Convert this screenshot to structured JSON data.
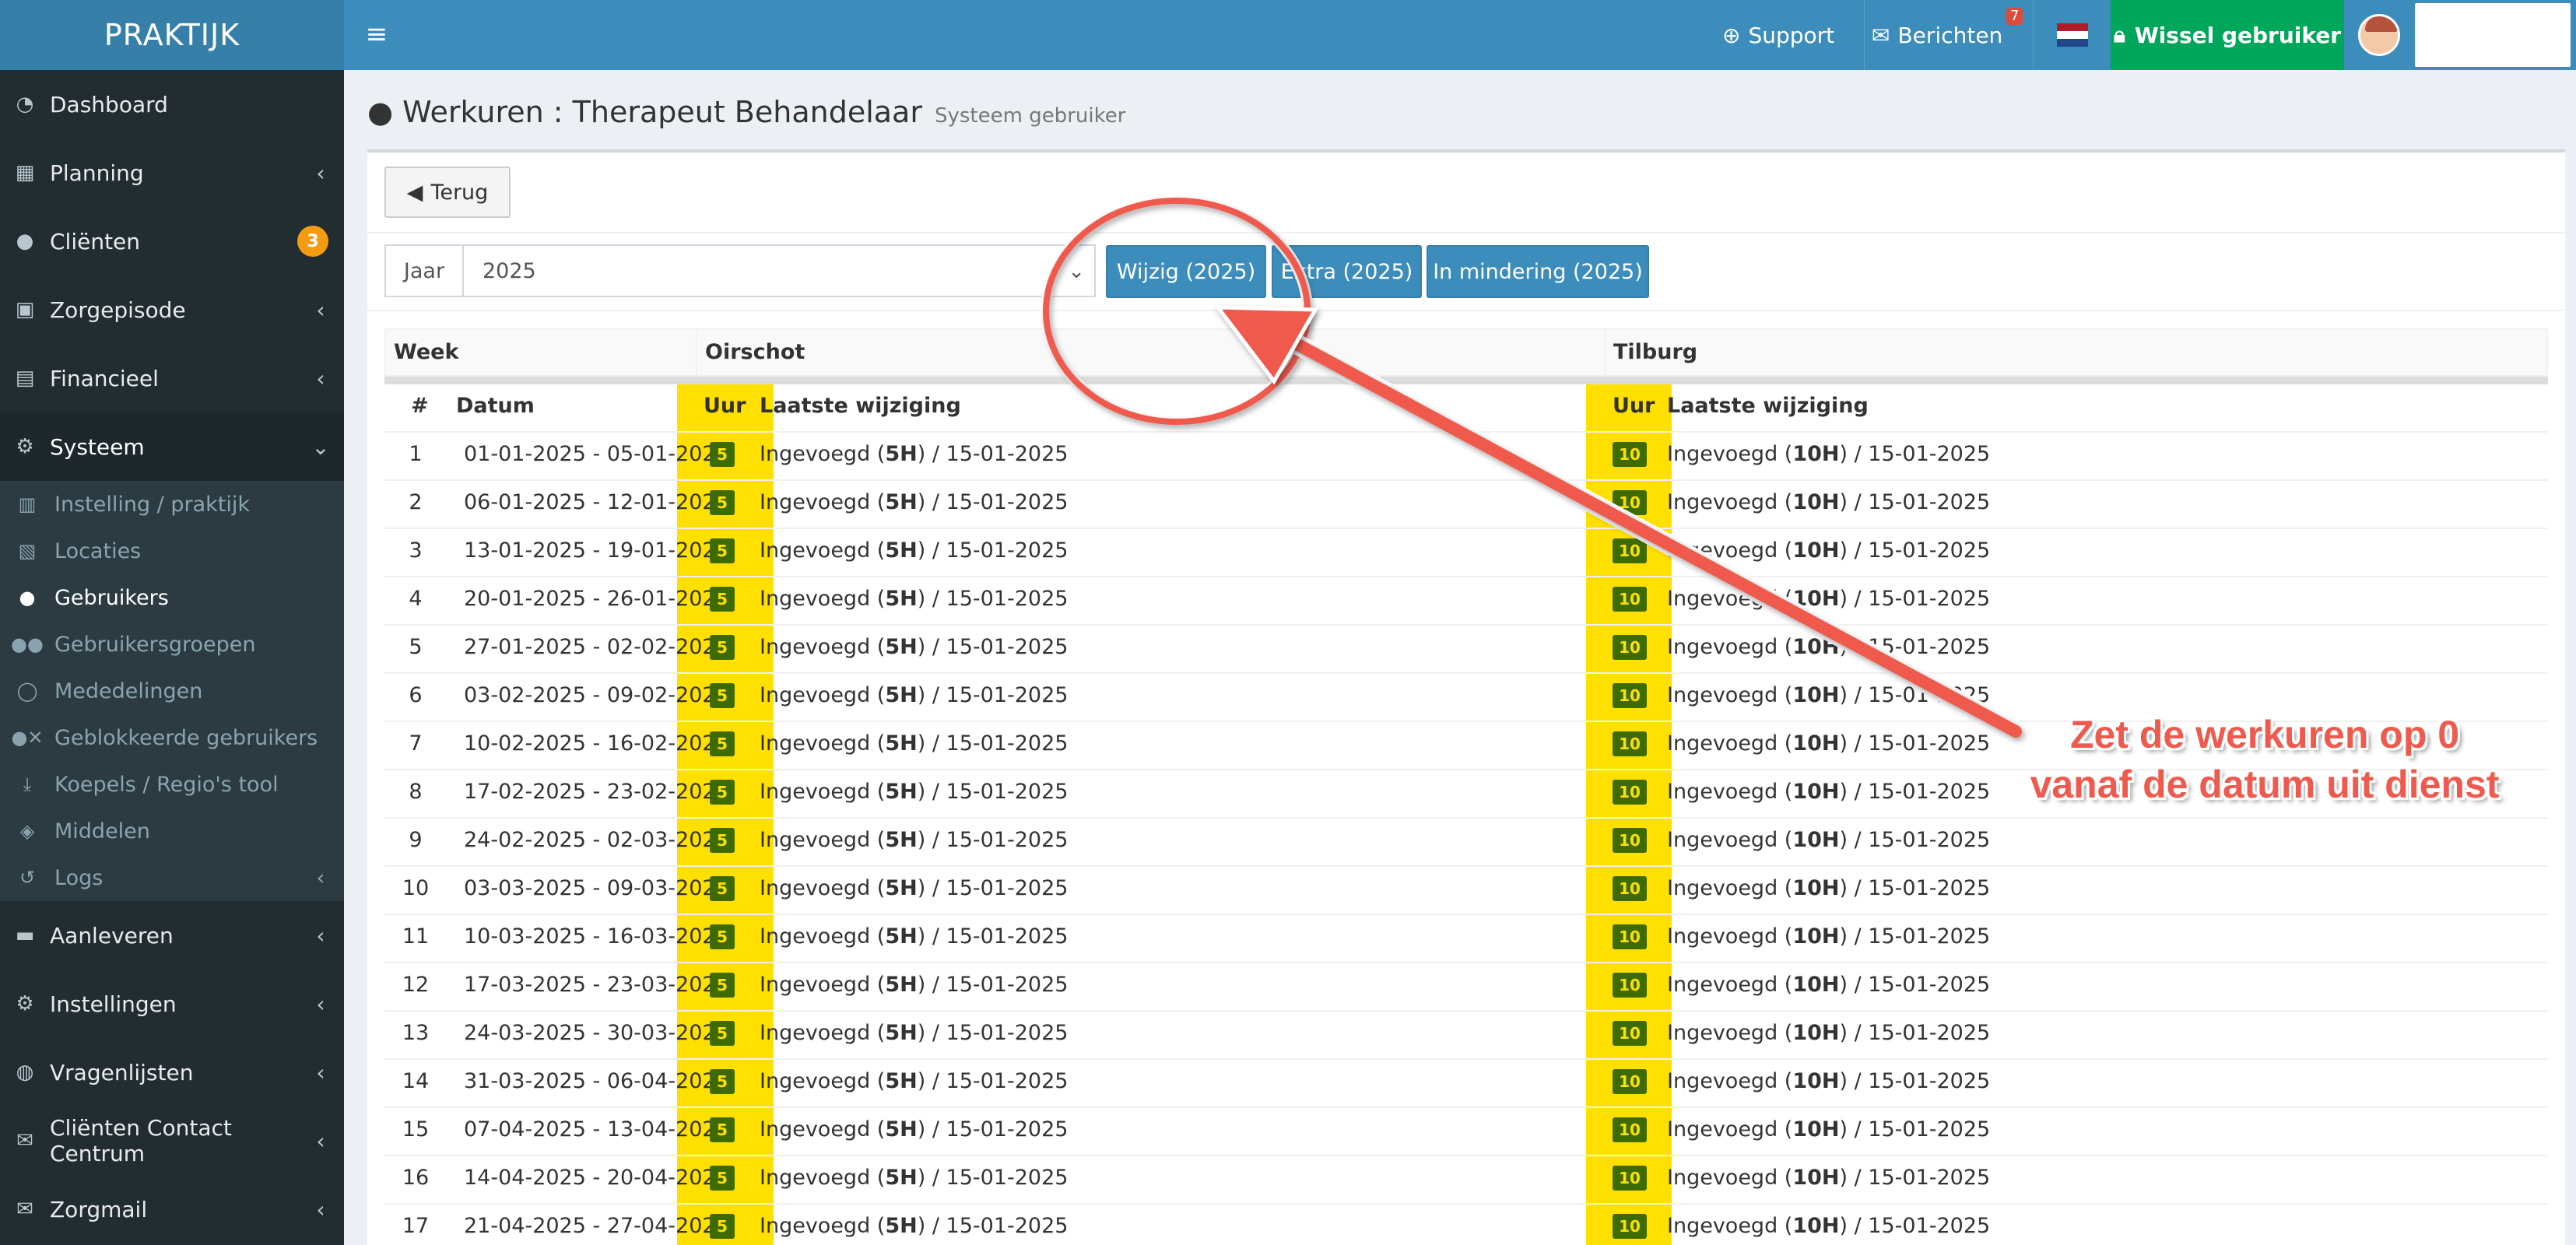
{
  "header": {
    "logo": "PRAKTIJK",
    "support": "Support",
    "berichten": "Berichten",
    "berichten_count": "7",
    "wissel": "Wissel gebruiker"
  },
  "sidebar": {
    "items": [
      {
        "label": "Dashboard",
        "icon": "dashboard-icon"
      },
      {
        "label": "Planning",
        "icon": "calendar-icon"
      },
      {
        "label": "Cliënten",
        "icon": "user-icon",
        "badge": "3"
      },
      {
        "label": "Zorgepisode",
        "icon": "medkit-icon"
      },
      {
        "label": "Financieel",
        "icon": "book-icon"
      },
      {
        "label": "Systeem",
        "icon": "cogs-icon"
      }
    ],
    "sub_items": [
      {
        "label": "Instelling / praktijk",
        "icon": "clipboard-icon"
      },
      {
        "label": "Locaties",
        "icon": "map-icon"
      },
      {
        "label": "Gebruikers",
        "icon": "user-icon"
      },
      {
        "label": "Gebruikersgroepen",
        "icon": "users-icon"
      },
      {
        "label": "Mededelingen",
        "icon": "comment-icon"
      },
      {
        "label": "Geblokkeerde gebruikers",
        "icon": "user-block-icon"
      },
      {
        "label": "Koepels / Regio's tool",
        "icon": "download-icon"
      },
      {
        "label": "Middelen",
        "icon": "cubes-icon"
      },
      {
        "label": "Logs",
        "icon": "history-icon"
      }
    ],
    "bottom_items": [
      {
        "label": "Aanleveren",
        "icon": "truck-icon"
      },
      {
        "label": "Instellingen",
        "icon": "gear-icon"
      },
      {
        "label": "Vragenlijsten",
        "icon": "globe-icon"
      },
      {
        "label": "Cliënten Contact Centrum",
        "icon": "envelope-icon"
      },
      {
        "label": "Zorgmail",
        "icon": "envelope-icon"
      }
    ]
  },
  "page": {
    "title": "Werkuren : Therapeut Behandelaar",
    "subtitle": "Systeem gebruiker",
    "back_label": "Terug",
    "year_label": "Jaar",
    "year_value": "2025",
    "btn_wijzig": "Wijzig (2025)",
    "btn_extra": "Extra (2025)",
    "btn_mindering": "In mindering (2025)"
  },
  "table": {
    "h_week": "Week",
    "h_loc1": "Oirschot",
    "h_loc2": "Tilburg",
    "h_num": "#",
    "h_datum": "Datum",
    "h_uur": "Uur",
    "h_laatste": "Laatste wijziging",
    "rows": [
      {
        "n": "1",
        "datum": "01-01-2025 - 05-01-2025"
      },
      {
        "n": "2",
        "datum": "06-01-2025 - 12-01-2025"
      },
      {
        "n": "3",
        "datum": "13-01-2025 - 19-01-2025"
      },
      {
        "n": "4",
        "datum": "20-01-2025 - 26-01-2025"
      },
      {
        "n": "5",
        "datum": "27-01-2025 - 02-02-2025"
      },
      {
        "n": "6",
        "datum": "03-02-2025 - 09-02-2025"
      },
      {
        "n": "7",
        "datum": "10-02-2025 - 16-02-2025"
      },
      {
        "n": "8",
        "datum": "17-02-2025 - 23-02-2025"
      },
      {
        "n": "9",
        "datum": "24-02-2025 - 02-03-2025"
      },
      {
        "n": "10",
        "datum": "03-03-2025 - 09-03-2025"
      },
      {
        "n": "11",
        "datum": "10-03-2025 - 16-03-2025"
      },
      {
        "n": "12",
        "datum": "17-03-2025 - 23-03-2025"
      },
      {
        "n": "13",
        "datum": "24-03-2025 - 30-03-2025"
      },
      {
        "n": "14",
        "datum": "31-03-2025 - 06-04-2025"
      },
      {
        "n": "15",
        "datum": "07-04-2025 - 13-04-2025"
      },
      {
        "n": "16",
        "datum": "14-04-2025 - 20-04-2025"
      },
      {
        "n": "17",
        "datum": "21-04-2025 - 27-04-2025"
      }
    ],
    "loc1": {
      "uur": "5",
      "pre": "Ingevoegd (",
      "bold": "5H",
      "post": ") / 15-01-2025"
    },
    "loc2": {
      "uur": "10",
      "pre": "Ingevoegd (",
      "bold": "10H",
      "post": ") / 15-01-2025"
    }
  },
  "annotation": {
    "line1": "Zet de werkuren op 0",
    "line2": "vanaf de datum uit dienst",
    "color": "#f05a4e"
  },
  "colors": {
    "header": "#3c8dbc",
    "sidebar": "#222d32",
    "green": "#00a65a",
    "highlight": "#ffe000"
  }
}
